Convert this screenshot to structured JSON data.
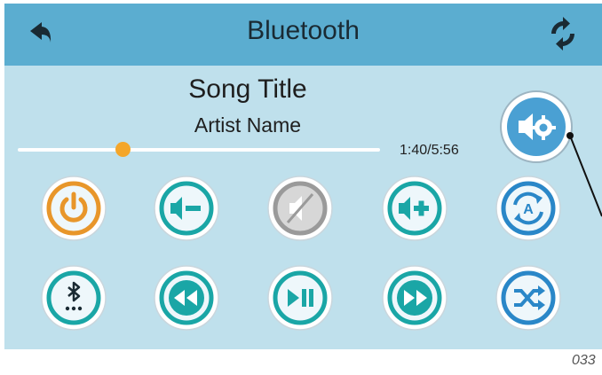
{
  "header": {
    "title": "Bluetooth",
    "back_icon": "back-arrow-icon",
    "refresh_icon": "refresh-icon"
  },
  "now_playing": {
    "song_title": "Song Title",
    "artist_name": "Artist Name",
    "time": "1:40/5:56",
    "progress": 0.29
  },
  "controls": [
    {
      "name": "power-button",
      "icon": "power-icon"
    },
    {
      "name": "volume-down-button",
      "icon": "volume-down-icon"
    },
    {
      "name": "mute-button",
      "icon": "mute-icon"
    },
    {
      "name": "volume-up-button",
      "icon": "volume-up-icon"
    },
    {
      "name": "auto-mode-button",
      "icon": "auto-repeat-icon"
    },
    {
      "name": "bluetooth-button",
      "icon": "bluetooth-icon"
    },
    {
      "name": "previous-button",
      "icon": "rewind-icon"
    },
    {
      "name": "play-pause-button",
      "icon": "play-pause-icon"
    },
    {
      "name": "next-button",
      "icon": "fast-forward-icon"
    },
    {
      "name": "shuffle-button",
      "icon": "shuffle-icon"
    }
  ],
  "settings": {
    "icon": "speaker-settings-icon"
  },
  "colors": {
    "header": "#5badd0",
    "background": "#bfe0ec",
    "teal": "#1aa6a6",
    "orange": "#e8962a",
    "blue": "#2a87c8",
    "gray": "#9a9a9a"
  },
  "footer": {
    "code": "033"
  }
}
